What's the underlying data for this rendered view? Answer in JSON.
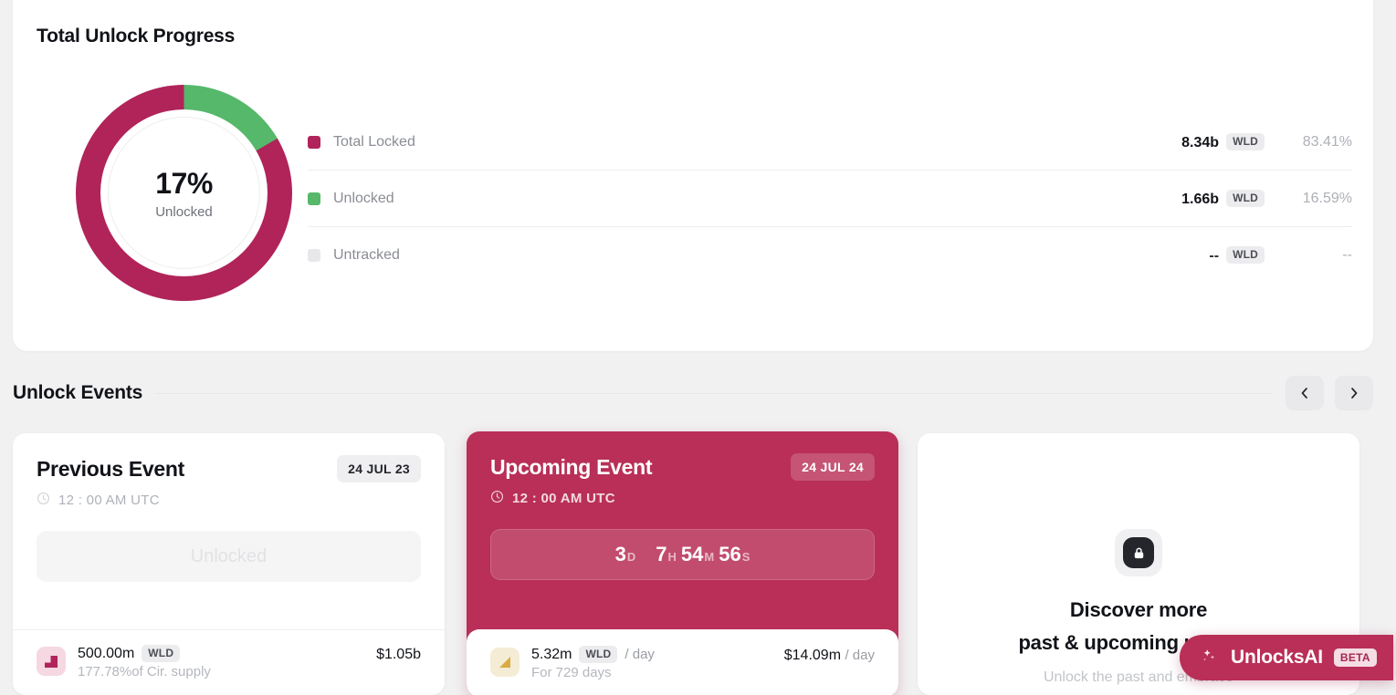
{
  "progress": {
    "title": "Total Unlock Progress",
    "donut": {
      "percent_label": "17%",
      "sub_label": "Unlocked"
    },
    "legend": [
      {
        "label": "Total Locked",
        "amount": "8.34b",
        "ticker": "WLD",
        "percent": "83.41%",
        "color": "#b0245a"
      },
      {
        "label": "Unlocked",
        "amount": "1.66b",
        "ticker": "WLD",
        "percent": "16.59%",
        "color": "#55b86a"
      },
      {
        "label": "Untracked",
        "amount": "--",
        "ticker": "WLD",
        "percent": "--",
        "color": "#e8e8ea"
      }
    ]
  },
  "events": {
    "heading": "Unlock Events",
    "prev_button_icon": "chevron-left-icon",
    "next_button_icon": "chevron-right-icon",
    "previous": {
      "title": "Previous Event",
      "date": "24 JUL 23",
      "time": "12 : 00 AM UTC",
      "status": "Unlocked",
      "amount": "500.00m",
      "ticker": "WLD",
      "supply_note": "177.78%of Cir. supply",
      "usd": "$1.05b",
      "icon": "cliff-unlock-icon"
    },
    "upcoming": {
      "title": "Upcoming Event",
      "date": "24 JUL 24",
      "time": "12 : 00 AM UTC",
      "countdown": [
        {
          "value": "3",
          "unit": "D"
        },
        {
          "value": "7",
          "unit": "H"
        },
        {
          "value": "54",
          "unit": "M"
        },
        {
          "value": "56",
          "unit": "S"
        }
      ],
      "amount": "5.32m",
      "ticker": "WLD",
      "rate_suffix": "/ day",
      "duration_note": "For 729 days",
      "usd": "$14.09m",
      "usd_suffix": "/ day",
      "icon": "linear-vesting-icon"
    },
    "promo": {
      "icon": "lock-icon",
      "title_line1": "Discover more",
      "title_line2": "past & upcoming unlocks",
      "subtitle": "Unlock the past and embrace"
    }
  },
  "ai_badge": {
    "icon": "sparkles-icon",
    "label": "UnlocksAI",
    "tag": "BETA"
  },
  "chart_data": {
    "type": "pie",
    "title": "Total Unlock Progress",
    "categories": [
      "Total Locked",
      "Unlocked",
      "Untracked"
    ],
    "values": [
      83.41,
      16.59,
      0
    ],
    "amounts": [
      "8.34b",
      "1.66b",
      "--"
    ],
    "unit": "WLD",
    "colors": [
      "#b0245a",
      "#55b86a",
      "#e8e8ea"
    ],
    "center_label": "17%",
    "center_sublabel": "Unlocked",
    "legend_position": "right",
    "donut": true
  }
}
